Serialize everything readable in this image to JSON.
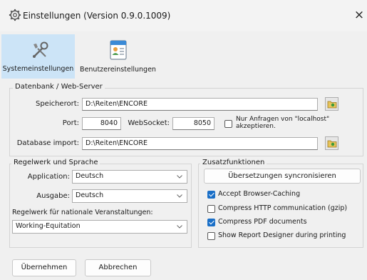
{
  "window": {
    "title": "Einstellungen (Version 0.9.0.1009)",
    "close_glyph": "×",
    "icon": "gear-icon"
  },
  "tabs": [
    {
      "label": "Systemeinstellungen",
      "icon": "tools-icon",
      "active": true
    },
    {
      "label": "Benutzereinstellungen",
      "icon": "user-card-icon",
      "active": false
    }
  ],
  "db_group": {
    "legend": "Datenbank / Web-Server",
    "storage_label": "Speicherort:",
    "storage_value": "D:\\Reiten\\ENCORE",
    "port_label": "Port:",
    "port_value": "8040",
    "websocket_label": "WebSocket:",
    "websocket_value": "8050",
    "localhost_only_label": "Nur Anfragen von \"localhost\" akzeptieren.",
    "localhost_only_checked": false,
    "import_label": "Database import:",
    "import_value": "D:\\Reiten\\ENCORE"
  },
  "rules_group": {
    "legend": "Regelwerk und Sprache",
    "application_label": "Application:",
    "application_value": "Deutsch",
    "output_label": "Ausgabe:",
    "output_value": "Deutsch",
    "national_label": "Regelwerk für nationale Veranstaltungen:",
    "national_value": "Working-Equitation"
  },
  "extra_group": {
    "legend": "Zusatzfunktionen",
    "sync_button": "Übersetzungen syncronisieren",
    "options": [
      {
        "label": "Accept Browser-Caching",
        "checked": true
      },
      {
        "label": "Compress HTTP communication (gzip)",
        "checked": false
      },
      {
        "label": "Compress PDF documents",
        "checked": true
      },
      {
        "label": "Show Report Designer during printing",
        "checked": false
      }
    ]
  },
  "footer": {
    "apply_button": "Übernehmen",
    "cancel_button": "Abbrechen"
  },
  "colors": {
    "active_tab": "#cce4f7",
    "checkbox_checked": "#1a6fc7",
    "window_bg": "#f0f0f0"
  }
}
